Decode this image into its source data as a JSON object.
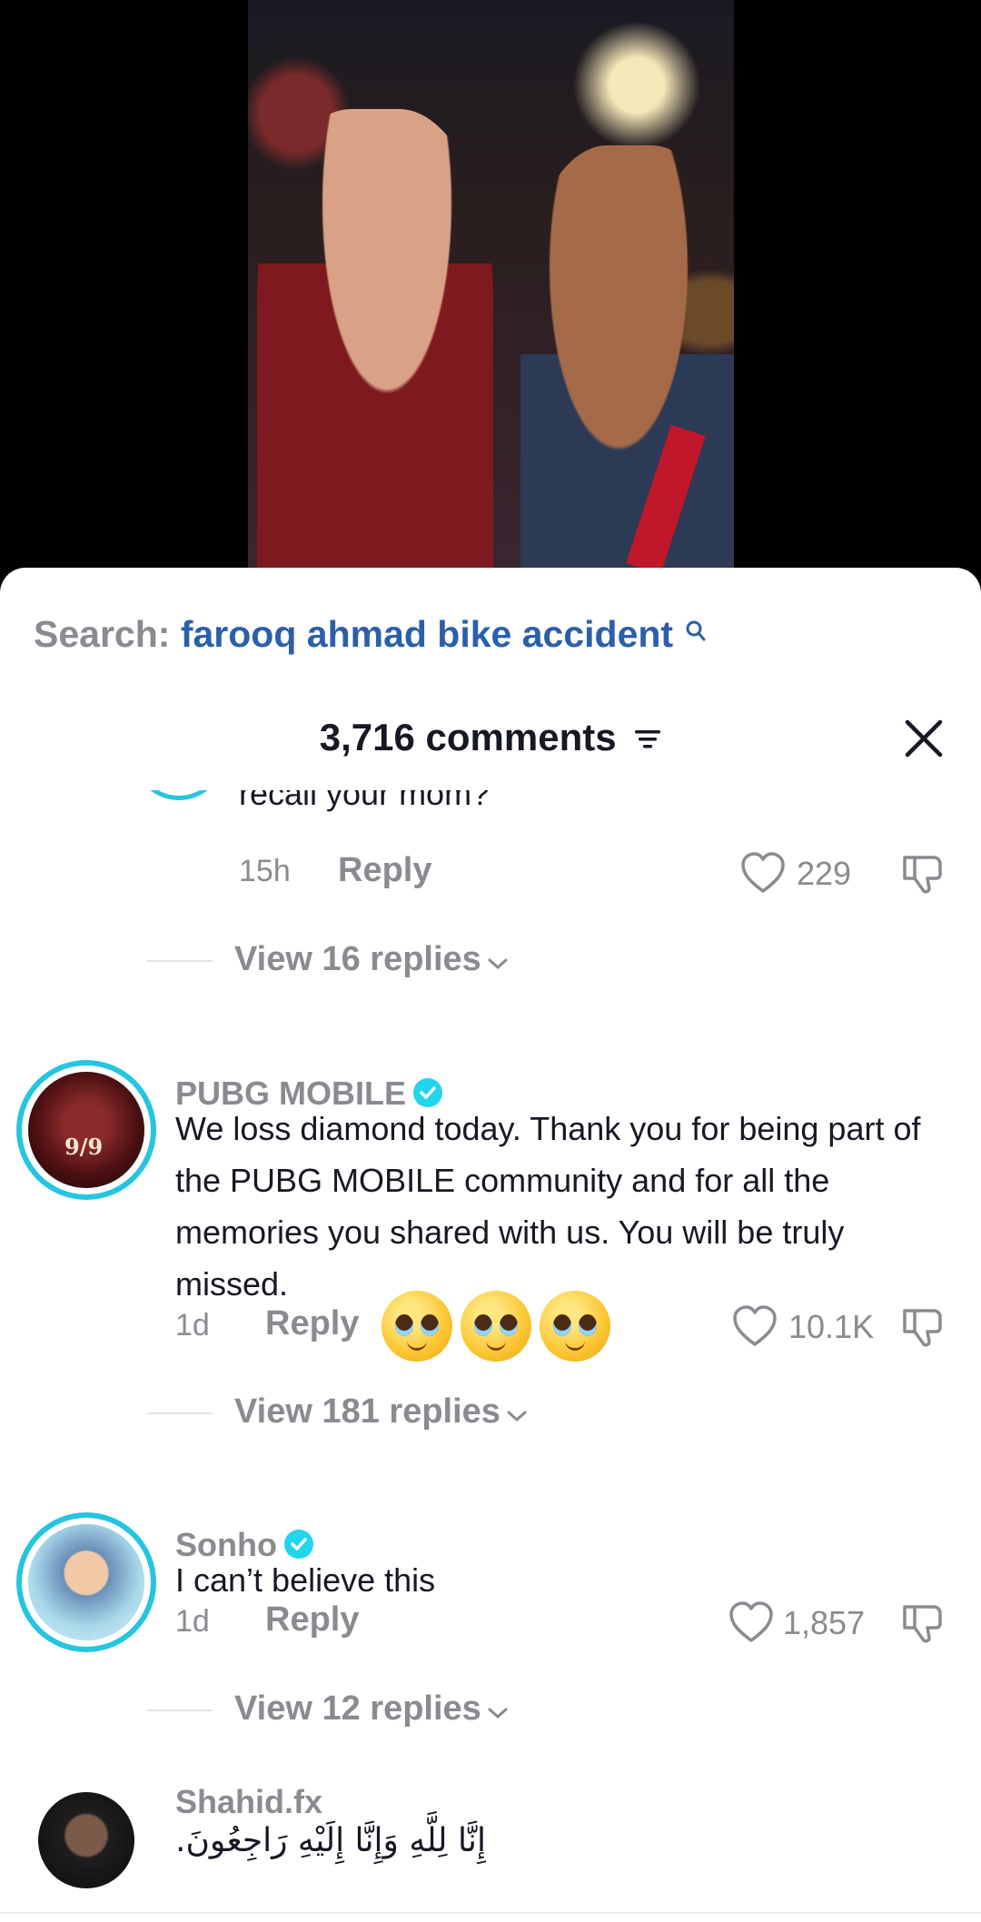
{
  "search": {
    "label": "Search:",
    "query": "farooq ahmad bike accident"
  },
  "header": {
    "count_label": "3,716 comments"
  },
  "comments": [
    {
      "partial_text": "recall your mom?",
      "time": "15h",
      "reply": "Reply",
      "likes": "229",
      "view_replies": "View 16 replies"
    },
    {
      "username": "PUBG MOBILE",
      "verified": true,
      "avatar_badge": "9/9",
      "text": "We loss diamond today. Thank you for being part of the PUBG MOBILE community and for all the memories you shared with us. You will be truly missed.",
      "time": "1d",
      "reply": "Reply",
      "likes": "10.1K",
      "view_replies": "View 181 replies"
    },
    {
      "username": "Sonho",
      "verified": true,
      "text": "I can’t believe this",
      "time": "1d",
      "reply": "Reply",
      "likes": "1,857",
      "view_replies": "View 12 replies"
    },
    {
      "username": "Shahid.fx",
      "verified": false,
      "text": "إِنَّا لِلَّهِ وَإِنَّا إِلَيْهِ رَاجِعُونَ."
    }
  ],
  "colors": {
    "accent_link": "#2b5fa9",
    "verified": "#20d5ec",
    "ring": "#25c5e0",
    "muted": "#8a8b91",
    "text": "#161823"
  }
}
